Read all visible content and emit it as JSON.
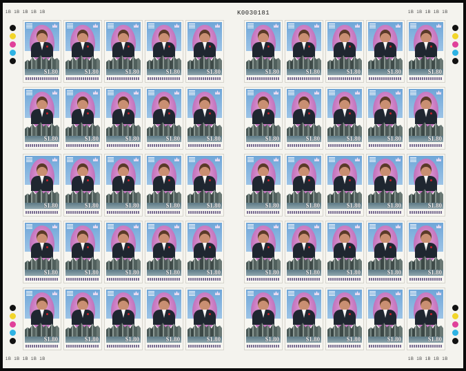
{
  "sheet": {
    "serial_number": "K0030181",
    "stamp_value": "$1.80",
    "plate_numbers": [
      "1B",
      "1B",
      "1B",
      "1B",
      "1B"
    ],
    "traffic_light_colors": [
      "#111111",
      "#f2d52a",
      "#e0409a",
      "#2fb3e4",
      "#111111"
    ],
    "panes": [
      {
        "name": "left",
        "rows": 5,
        "columns": 5
      },
      {
        "name": "right",
        "rows": 5,
        "columns": 5
      }
    ]
  }
}
